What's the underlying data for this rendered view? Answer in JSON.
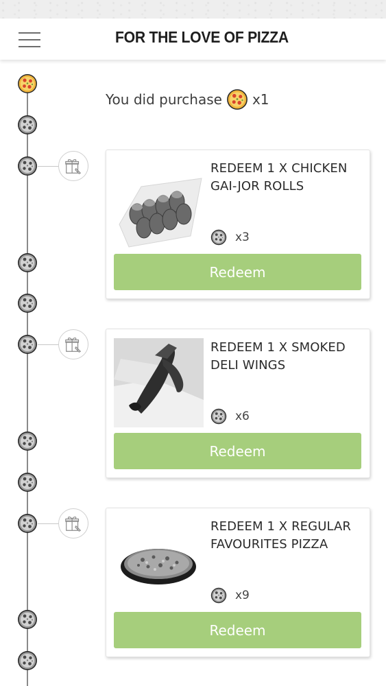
{
  "header": {
    "title": "FOR THE LOVE OF PIZZA"
  },
  "purchase": {
    "prefix": "You did purchase",
    "count": "x1"
  },
  "rewards": [
    {
      "title": "REDEEM 1 X CHICKEN GAI-JOR ROLLS",
      "cost": "x3",
      "button_label": "Redeem",
      "image_icon": "chicken-rolls-image"
    },
    {
      "title": "REDEEM 1 X SMOKED DELI WINGS",
      "cost": "x6",
      "button_label": "Redeem",
      "image_icon": "chicken-wings-image"
    },
    {
      "title": "REDEEM 1 X REGULAR FAVOURITES PIZZA",
      "cost": "x9",
      "button_label": "Redeem",
      "image_icon": "pizza-image"
    }
  ],
  "timeline": {
    "active_icon": "pizza-color-icon",
    "inactive_icon": "pizza-gray-icon",
    "gift_icon": "gift-icon"
  },
  "colors": {
    "redeem_button": "#a6ce7c",
    "pizza_crust": "#f0b43c",
    "pizza_pepperoni": "#d9442b",
    "timeline_line": "#8a8a8a"
  }
}
